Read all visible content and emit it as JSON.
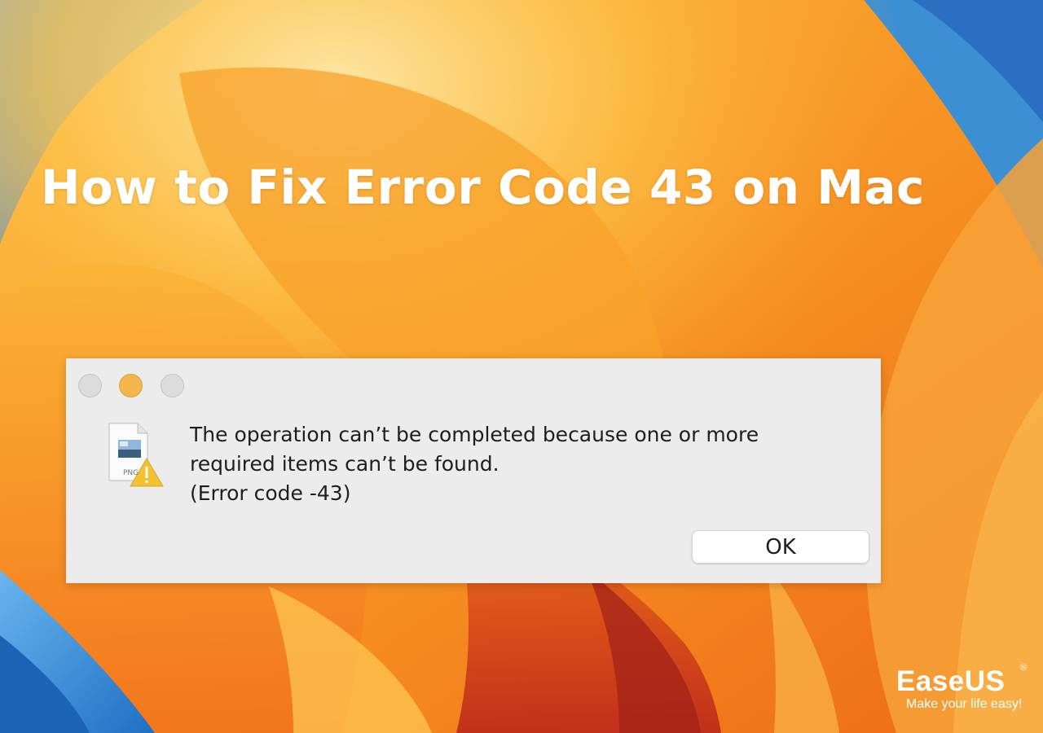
{
  "headline": "How to Fix Error Code 43 on Mac",
  "dialog": {
    "traffic_lights": {
      "close_color": "#dcdcdc",
      "minimize_color": "#f3b64c",
      "zoom_color": "#dcdcdc"
    },
    "file_icon": {
      "icon": "png-file-warning-icon",
      "type_label": "PNG"
    },
    "message_lines": [
      "The operation can’t be completed because one or more",
      "required items can’t be found.",
      "(Error code -43)"
    ],
    "ok_label": "OK"
  },
  "brand": {
    "name": "EaseUS",
    "registered": "®",
    "tagline": "Make your life easy!"
  },
  "colors": {
    "wallpaper_orange": "#f58a1e",
    "wallpaper_yellow": "#fcc63a",
    "wallpaper_blue": "#2f86d4",
    "dialog_background": "#ececec"
  }
}
